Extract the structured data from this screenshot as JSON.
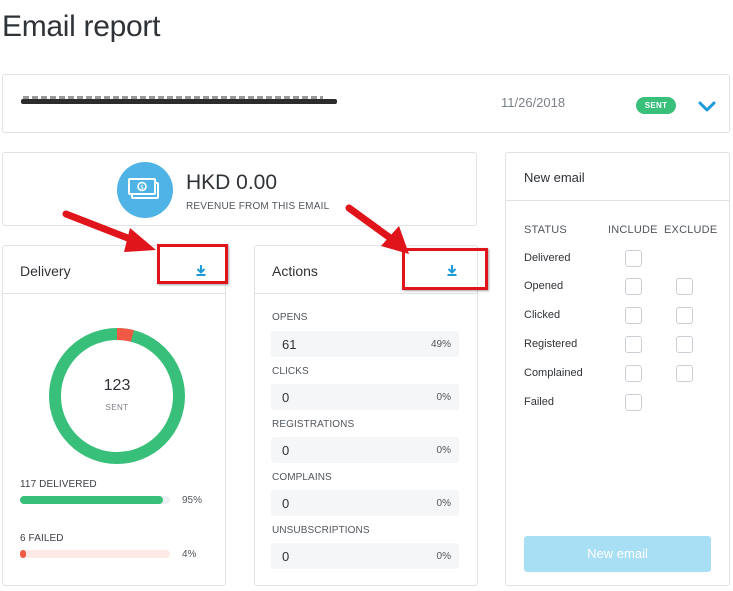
{
  "page": {
    "title": "Email report"
  },
  "email": {
    "subject": "",
    "date": "11/26/2018",
    "status_badge": "SENT",
    "expand_icon": "chevron-down-icon"
  },
  "revenue": {
    "amount": "HKD 0.00",
    "label": "REVENUE FROM THIS EMAIL",
    "icon": "money-icon"
  },
  "delivery": {
    "title": "Delivery",
    "download_icon": "download-icon",
    "total": "123",
    "total_label": "SENT",
    "delivered": {
      "label": "117 DELIVERED",
      "pct_text": "95%",
      "fraction": 0.95
    },
    "failed": {
      "label": "6 FAILED",
      "pct_text": "4%",
      "fraction": 0.04
    },
    "colors": {
      "delivered": "#38c07a",
      "failed": "#f05a44",
      "failed_track": "#fdeae7",
      "delivered_track": "#eef1f3"
    }
  },
  "actions": {
    "title": "Actions",
    "download_icon": "download-icon",
    "items": [
      {
        "label": "OPENS",
        "value": "61",
        "pct": "49%"
      },
      {
        "label": "CLICKS",
        "value": "0",
        "pct": "0%"
      },
      {
        "label": "REGISTRATIONS",
        "value": "0",
        "pct": "0%"
      },
      {
        "label": "COMPLAINS",
        "value": "0",
        "pct": "0%"
      },
      {
        "label": "UNSUBSCRIPTIONS",
        "value": "0",
        "pct": "0%"
      }
    ]
  },
  "new_email": {
    "title": "New email",
    "col_status": "STATUS",
    "col_include": "INCLUDE",
    "col_exclude": "EXCLUDE",
    "statuses": [
      "Delivered",
      "Opened",
      "Clicked",
      "Registered",
      "Complained",
      "Failed"
    ],
    "button": "New email"
  },
  "colors": {
    "accent": "#1e9ad6",
    "badge": "#38c07a",
    "annotation": "#e0141b"
  }
}
